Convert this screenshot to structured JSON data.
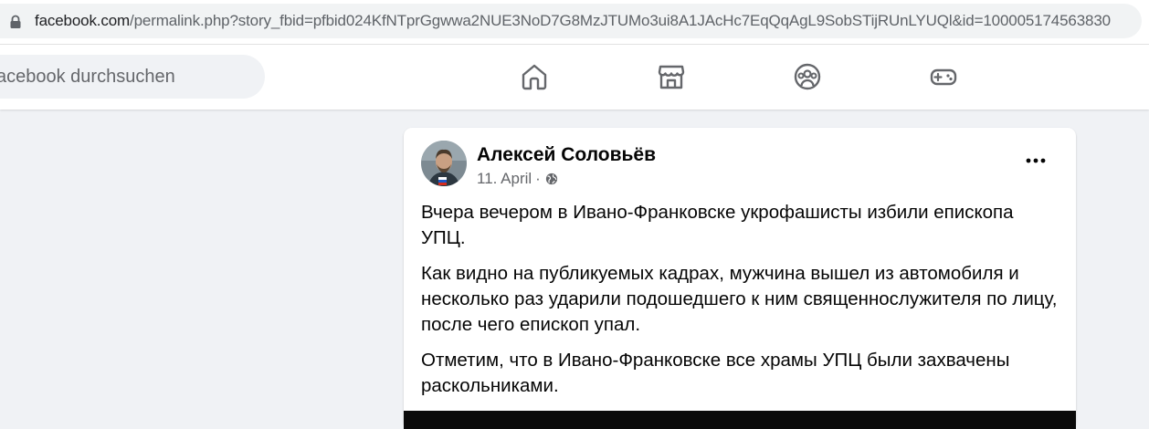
{
  "browser": {
    "url_domain": "facebook.com",
    "url_path": "/permalink.php?story_fbid=pfbid024KfNTprGgwwa2NUE3NoD7G8MzJTUMo3ui8A1JAcHc7EqQqAgL9SobSTijRUnLYUQl&id=100005174563830"
  },
  "nav": {
    "search_placeholder": "acebook durchsuchen",
    "icons": [
      "home-icon",
      "marketplace-icon",
      "groups-icon",
      "gaming-icon"
    ]
  },
  "post": {
    "author": "Алексей Соловьёв",
    "date": "11. April",
    "separator": "·",
    "audience_icon": "globe-icon",
    "paragraphs": [
      "Вчера вечером в Ивано-Франковске укрофашисты избили епископа УПЦ.",
      "Как видно на публикуемых кадрах, мужчина вышел из автомобиля и несколько раз ударили подошедшего к ним священнослужителя по лицу, после чего епископ упал.",
      "Отметим, что в Ивано-Франковске все храмы УПЦ были захвачены раскольниками."
    ]
  },
  "colors": {
    "page_bg": "#f0f2f5",
    "icon": "#65676b",
    "text": "#050505",
    "secondary_text": "#65676b"
  }
}
